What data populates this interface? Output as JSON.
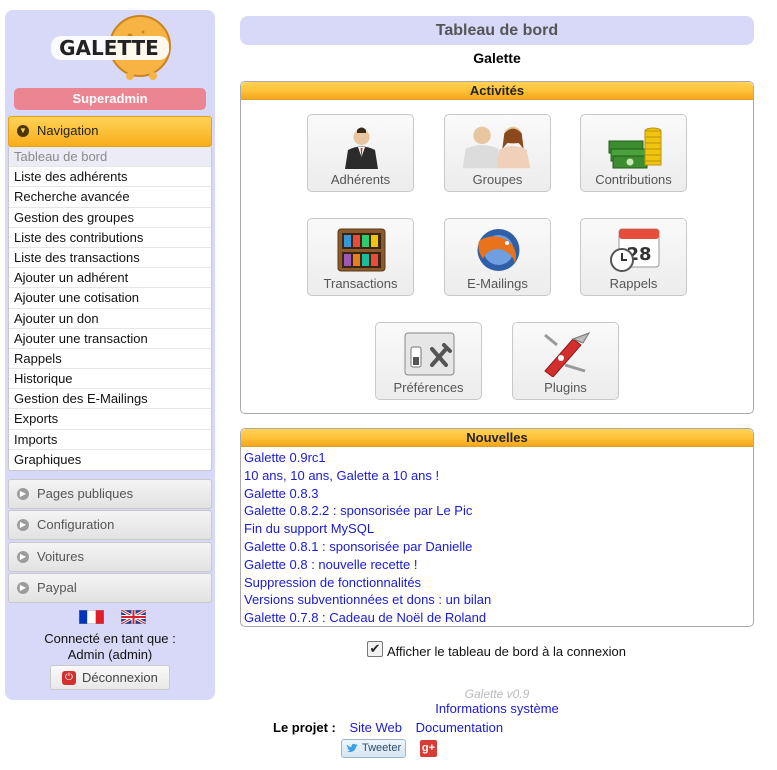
{
  "app": {
    "logo_text": "GALETTE",
    "user_badge": "Superadmin",
    "colors": {
      "sidebar_bg": "#d8d8f8",
      "accent": "#f8ae1b",
      "badge": "#ec8592",
      "link": "#1a1ad6"
    }
  },
  "sidebar": {
    "navigation": {
      "label": "Navigation",
      "items": [
        {
          "label": "Tableau de bord",
          "active": true
        },
        {
          "label": "Liste des adhérents"
        },
        {
          "label": "Recherche avancée"
        },
        {
          "label": "Gestion des groupes"
        },
        {
          "label": "Liste des contributions"
        },
        {
          "label": "Liste des transactions"
        },
        {
          "label": "Ajouter un adhérent"
        },
        {
          "label": "Ajouter une cotisation"
        },
        {
          "label": "Ajouter un don"
        },
        {
          "label": "Ajouter une transaction"
        },
        {
          "label": "Rappels"
        },
        {
          "label": "Historique"
        },
        {
          "label": "Gestion des E-Mailings"
        },
        {
          "label": "Exports"
        },
        {
          "label": "Imports"
        },
        {
          "label": "Graphiques"
        }
      ]
    },
    "sections": [
      {
        "label": "Pages publiques",
        "icon": "arrow-right-icon"
      },
      {
        "label": "Configuration",
        "icon": "arrow-right-icon"
      },
      {
        "label": "Voitures",
        "icon": "arrow-right-icon"
      },
      {
        "label": "Paypal",
        "icon": "arrow-right-icon"
      }
    ],
    "connected_label": "Connecté en tant que :",
    "connected_user": "Admin (admin)",
    "logout_label": "Déconnexion"
  },
  "main": {
    "title": "Tableau de bord",
    "instance": "Galette",
    "activities": {
      "header": "Activités",
      "tiles": [
        {
          "label": "Adhérents",
          "icon": "member-icon"
        },
        {
          "label": "Groupes",
          "icon": "group-icon"
        },
        {
          "label": "Contributions",
          "icon": "money-icon"
        },
        {
          "label": "Transactions",
          "icon": "transactions-icon"
        },
        {
          "label": "E-Mailings",
          "icon": "mailing-icon"
        },
        {
          "label": "Rappels",
          "icon": "calendar-clock-icon"
        },
        {
          "label": "Préférences",
          "icon": "preferences-icon"
        },
        {
          "label": "Plugins",
          "icon": "plugins-icon"
        }
      ]
    },
    "news": {
      "header": "Nouvelles",
      "items": [
        "Galette 0.9rc1",
        "10 ans, 10 ans, Galette a 10 ans !",
        "Galette 0.8.3",
        "Galette 0.8.2.2 : sponsorisée par Le Pic",
        "Fin du support MySQL",
        "Galette 0.8.1 : sponsorisée par Danielle",
        "Galette 0.8 : nouvelle recette !",
        "Suppression de fonctionnalités",
        "Versions subventionnées et dons : un bilan",
        "Galette 0.7.8 : Cadeau de Noël de Roland"
      ]
    },
    "show_dashboard": {
      "label": "Afficher le tableau de bord à la connexion",
      "checked": true
    }
  },
  "footer": {
    "version": "Galette v0.9",
    "sysinfo": "Informations système",
    "project_label": "Le projet :",
    "links": [
      "Site Web",
      "Documentation"
    ],
    "tweet_label": "Tweeter",
    "gplus_label": "g+"
  }
}
